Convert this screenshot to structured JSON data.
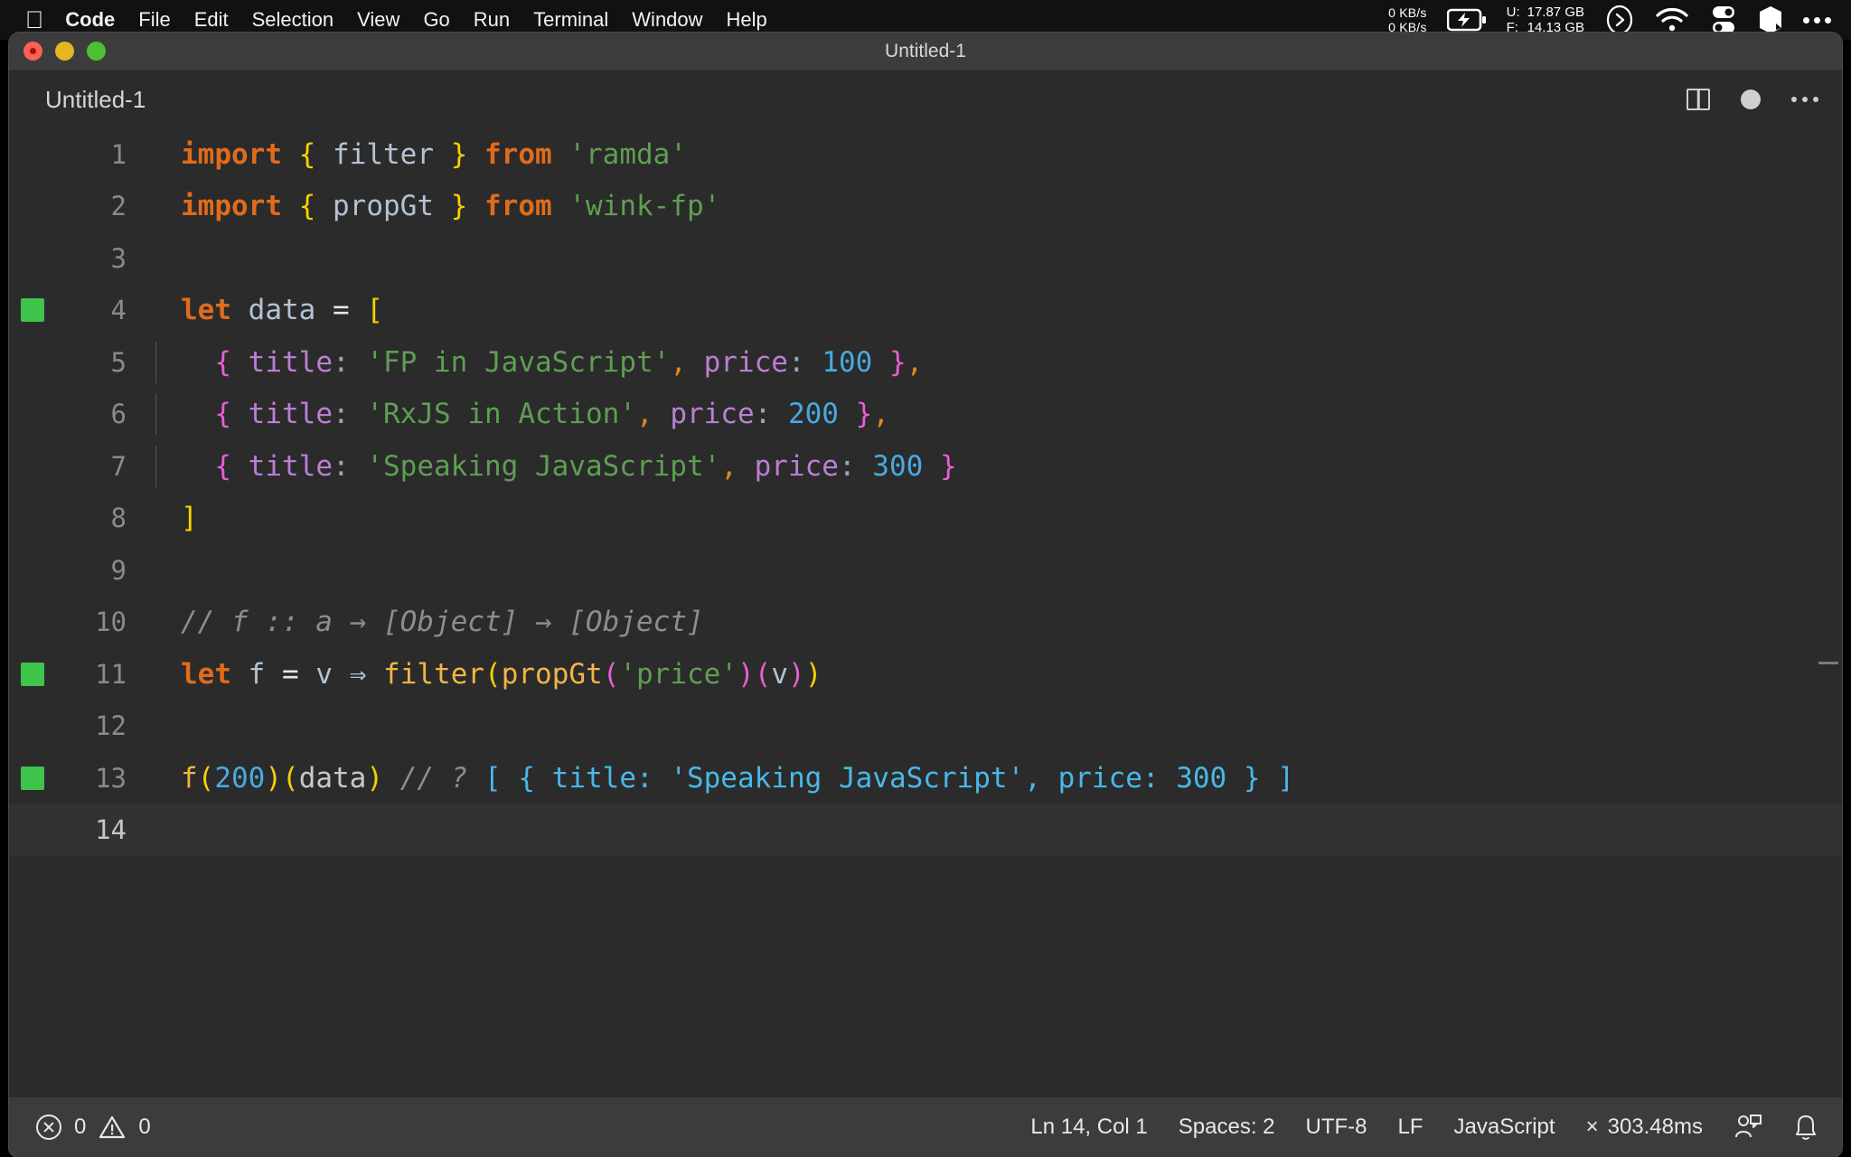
{
  "menubar": {
    "apple_icon": "apple-logo",
    "items": [
      {
        "label": "Code",
        "bold": true
      },
      {
        "label": "File",
        "bold": false
      },
      {
        "label": "Edit",
        "bold": false
      },
      {
        "label": "Selection",
        "bold": false
      },
      {
        "label": "View",
        "bold": false
      },
      {
        "label": "Go",
        "bold": false
      },
      {
        "label": "Run",
        "bold": false
      },
      {
        "label": "Terminal",
        "bold": false
      },
      {
        "label": "Window",
        "bold": false
      },
      {
        "label": "Help",
        "bold": false
      }
    ],
    "status": {
      "net_up": "0 KB/s",
      "net_down": "0 KB/s",
      "battery_icon": "battery-charging-icon",
      "mem_used_label": "U:",
      "mem_used_value": "17.87 GB",
      "mem_free_label": "F:",
      "mem_free_value": "14.13 GB",
      "terminal_icon": "terminal-prompt-icon",
      "wifi_icon": "wifi-icon",
      "control_center_icon": "control-center-icon",
      "shortcuts_icon": "shortcuts-icon",
      "more_icon": "more-ellipsis-icon"
    }
  },
  "window": {
    "title": "Untitled-1",
    "traffic_lights": [
      "close",
      "minimize",
      "zoom"
    ]
  },
  "tabbar": {
    "tab_label": "Untitled-1",
    "split_editor_icon": "split-editor-icon",
    "unsaved_dot_icon": "unsaved-changes-dot-icon",
    "more_actions_icon": "more-actions-ellipsis-icon"
  },
  "editor": {
    "language": "JavaScript",
    "current_line": 14,
    "lines": [
      {
        "n": "1",
        "mark": false,
        "guide": false
      },
      {
        "n": "2",
        "mark": false,
        "guide": false
      },
      {
        "n": "3",
        "mark": false,
        "guide": false
      },
      {
        "n": "4",
        "mark": true,
        "guide": false
      },
      {
        "n": "5",
        "mark": false,
        "guide": true
      },
      {
        "n": "6",
        "mark": false,
        "guide": true
      },
      {
        "n": "7",
        "mark": false,
        "guide": true
      },
      {
        "n": "8",
        "mark": false,
        "guide": false
      },
      {
        "n": "9",
        "mark": false,
        "guide": false
      },
      {
        "n": "10",
        "mark": false,
        "guide": false
      },
      {
        "n": "11",
        "mark": true,
        "guide": false
      },
      {
        "n": "12",
        "mark": false,
        "guide": false
      },
      {
        "n": "13",
        "mark": true,
        "guide": false
      },
      {
        "n": "14",
        "mark": false,
        "guide": false
      }
    ],
    "text": {
      "l1_import": "import",
      "l1_brace_open": "{",
      "l1_name": "filter",
      "l1_brace_close": "}",
      "l1_from": "from",
      "l1_module": "'ramda'",
      "l2_import": "import",
      "l2_brace_open": "{",
      "l2_name": "propGt",
      "l2_brace_close": "}",
      "l2_from": "from",
      "l2_module": "'wink-fp'",
      "l4_let": "let",
      "l4_name": "data",
      "l4_eq": "=",
      "l4_bracket": "[",
      "l5_brace_open": "{",
      "l5_key": "title",
      "l5_colon": ":",
      "l5_str": "'FP in JavaScript'",
      "l5_comma": ",",
      "l5_key2": "price",
      "l5_colon2": ":",
      "l5_num": "100",
      "l5_brace_close": "}",
      "l5_comma2": ",",
      "l6_brace_open": "{",
      "l6_key": "title",
      "l6_colon": ":",
      "l6_str": "'RxJS in Action'",
      "l6_comma": ",",
      "l6_key2": "price",
      "l6_colon2": ":",
      "l6_num": "200",
      "l6_brace_close": "}",
      "l6_comma2": ",",
      "l7_brace_open": "{",
      "l7_key": "title",
      "l7_colon": ":",
      "l7_str": "'Speaking JavaScript'",
      "l7_comma": ",",
      "l7_key2": "price",
      "l7_colon2": ":",
      "l7_num": "300",
      "l7_brace_close": "}",
      "l8_bracket": "]",
      "l10_comment": "// f :: a → [Object] → [Object]",
      "l11_let": "let",
      "l11_name": "f",
      "l11_eq": "=",
      "l11_param": "v",
      "l11_arrow": "⇒",
      "l11_fn1": "filter",
      "l11_p1": "(",
      "l11_fn2": "propGt",
      "l11_p2": "(",
      "l11_str": "'price'",
      "l11_p2c": ")",
      "l11_p3": "(",
      "l11_v": "v",
      "l11_p3c": ")",
      "l11_p1c": ")",
      "l13_fn": "f",
      "l13_p1": "(",
      "l13_num": "200",
      "l13_p1c": ")",
      "l13_p2": "(",
      "l13_arg": "data",
      "l13_p2c": ")",
      "l13_comment": "// ?",
      "l13_result": "[ { title: 'Speaking JavaScript', price: 300 } ]"
    }
  },
  "statusbar": {
    "error_icon": "error-circle-icon",
    "error_count": "0",
    "warning_icon": "warning-triangle-icon",
    "warning_count": "0",
    "cursor_position": "Ln 14, Col 1",
    "indentation": "Spaces: 2",
    "encoding": "UTF-8",
    "eol": "LF",
    "language_mode": "JavaScript",
    "quokka_icon": "×",
    "quokka_time": "303.48ms",
    "remote_icon": "live-share-icon",
    "bell_icon": "notifications-bell-icon"
  },
  "colors": {
    "editor_bg": "#2b2b2b",
    "chrome_bg": "#3c3c3c",
    "keyword": "#e06c1b",
    "string": "#5f9e53",
    "number": "#49a9e0",
    "function": "#f2b544",
    "property": "#bb7fd4",
    "comment": "#8d8d8d",
    "bracket1": "#f5d000",
    "bracket2": "#e85fd6",
    "gutter_mark": "#3fc44b"
  }
}
